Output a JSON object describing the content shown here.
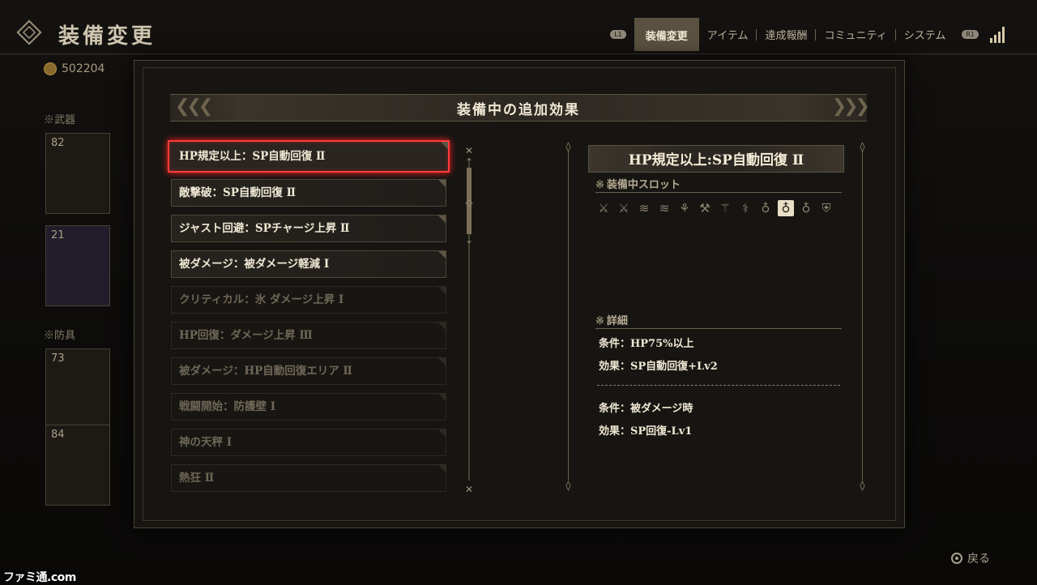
{
  "header": {
    "title": "装備変更",
    "l1_tag": "L1",
    "r1_tag": "R1",
    "tabs": [
      "装備変更",
      "アイテム",
      "達成報酬",
      "コミュニティ",
      "システム"
    ],
    "active_tab": "装備変更"
  },
  "currency": {
    "value": "502204"
  },
  "background": {
    "section_weapon": "※武器",
    "section_armor": "※防具",
    "card_levels": [
      "82",
      "21",
      "73",
      "84"
    ],
    "back_label": "戻る"
  },
  "modal": {
    "title": "装備中の追加効果",
    "items": [
      {
        "label": "HP規定以上：SP自動回復 Ⅱ",
        "state": "selected"
      },
      {
        "label": "敵撃破：SP自動回復 Ⅱ",
        "state": "active"
      },
      {
        "label": "ジャスト回避：SPチャージ上昇 Ⅱ",
        "state": "active"
      },
      {
        "label": "被ダメージ：被ダメージ軽減 Ⅰ",
        "state": "active"
      },
      {
        "label": "クリティカル：氷 ダメージ上昇 Ⅰ",
        "state": "dim"
      },
      {
        "label": "HP回復：ダメージ上昇 Ⅲ",
        "state": "dim"
      },
      {
        "label": "被ダメージ：HP自動回復エリア Ⅱ",
        "state": "dim"
      },
      {
        "label": "戦闘開始：防護壁 Ⅰ",
        "state": "dim"
      },
      {
        "label": "神の天秤 Ⅰ",
        "state": "dim"
      },
      {
        "label": "熱狂 Ⅱ",
        "state": "dim"
      }
    ]
  },
  "detail": {
    "title": "HP規定以上:SP自動回復 Ⅱ",
    "slots_label": "装備中スロット",
    "details_label": "詳細",
    "slot_icons": [
      "sword-icon",
      "sword-icon",
      "wave-icon",
      "wave-icon",
      "sickle-icon",
      "gun-icon",
      "dagger-icon",
      "staff-icon",
      "ring-icon",
      "ring-icon",
      "ring-icon",
      "shield-icon"
    ],
    "active_slot_index": 9,
    "effects": [
      {
        "condition": "条件：HP75%以上",
        "effect": "効果：SP自動回復+Lv2"
      },
      {
        "condition": "条件：被ダメージ時",
        "effect": "効果：SP回復-Lv1"
      }
    ]
  },
  "watermark": "ファミ通.com",
  "colors": {
    "highlight": "#ff3b3b",
    "gold": "#b59a5a",
    "text": "#efe8d4"
  }
}
